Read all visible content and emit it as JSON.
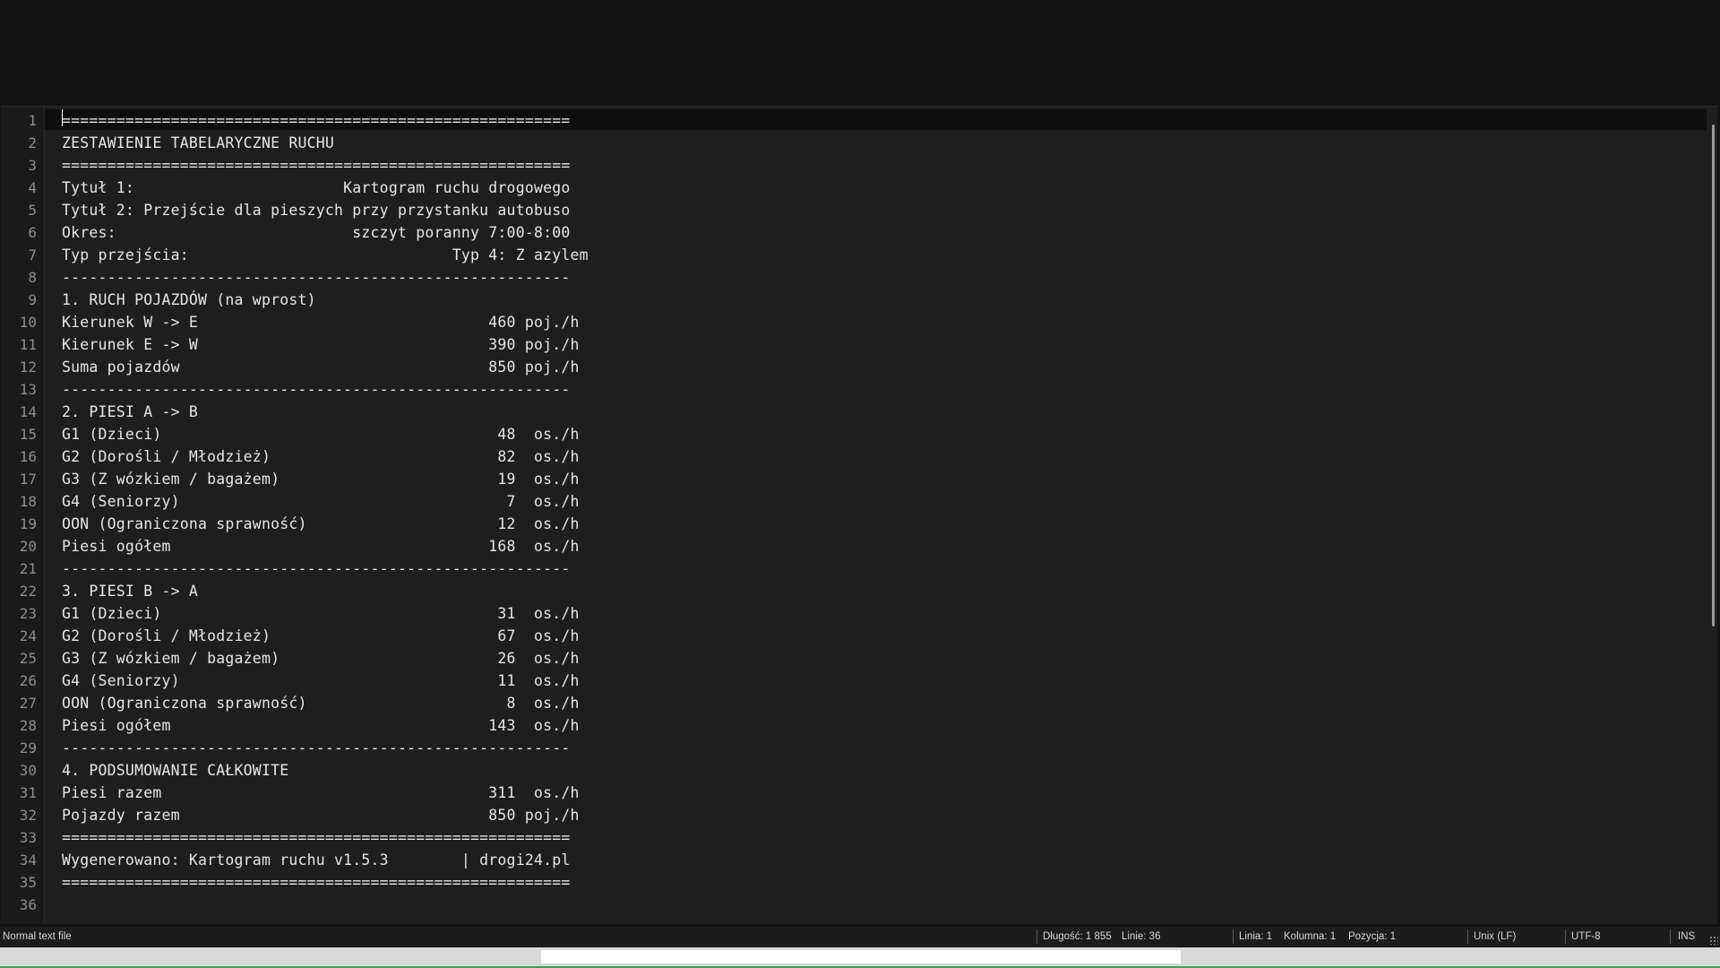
{
  "editor": {
    "lines": [
      {
        "n": "1",
        "text": "========================================================"
      },
      {
        "n": "2",
        "text": "ZESTAWIENIE TABELARYCZNE RUCHU"
      },
      {
        "n": "3",
        "text": "========================================================"
      },
      {
        "n": "4",
        "text": "Tytuł 1:                       Kartogram ruchu drogowego"
      },
      {
        "n": "5",
        "text": "Tytuł 2: Przejście dla pieszych przy przystanku autobuso"
      },
      {
        "n": "6",
        "text": "Okres:                          szczyt poranny 7:00-8:00"
      },
      {
        "n": "7",
        "text": "Typ przejścia:                             Typ 4: Z azylem"
      },
      {
        "n": "8",
        "text": "--------------------------------------------------------"
      },
      {
        "n": "9",
        "text": "1. RUCH POJAZDÓW (na wprost)"
      },
      {
        "n": "10",
        "text": "Kierunek W -> E                                460 poj./h"
      },
      {
        "n": "11",
        "text": "Kierunek E -> W                                390 poj./h"
      },
      {
        "n": "12",
        "text": "Suma pojazdów                                  850 poj./h"
      },
      {
        "n": "13",
        "text": "--------------------------------------------------------"
      },
      {
        "n": "14",
        "text": "2. PIESI A -> B"
      },
      {
        "n": "15",
        "text": "G1 (Dzieci)                                     48  os./h"
      },
      {
        "n": "16",
        "text": "G2 (Dorośli / Młodzież)                         82  os./h"
      },
      {
        "n": "17",
        "text": "G3 (Z wózkiem / bagażem)                        19  os./h"
      },
      {
        "n": "18",
        "text": "G4 (Seniorzy)                                    7  os./h"
      },
      {
        "n": "19",
        "text": "OON (Ograniczona sprawność)                     12  os./h"
      },
      {
        "n": "20",
        "text": "Piesi ogółem                                   168  os./h"
      },
      {
        "n": "21",
        "text": "--------------------------------------------------------"
      },
      {
        "n": "22",
        "text": "3. PIESI B -> A"
      },
      {
        "n": "23",
        "text": "G1 (Dzieci)                                     31  os./h"
      },
      {
        "n": "24",
        "text": "G2 (Dorośli / Młodzież)                         67  os./h"
      },
      {
        "n": "25",
        "text": "G3 (Z wózkiem / bagażem)                        26  os./h"
      },
      {
        "n": "26",
        "text": "G4 (Seniorzy)                                   11  os./h"
      },
      {
        "n": "27",
        "text": "OON (Ograniczona sprawność)                      8  os./h"
      },
      {
        "n": "28",
        "text": "Piesi ogółem                                   143  os./h"
      },
      {
        "n": "29",
        "text": "--------------------------------------------------------"
      },
      {
        "n": "30",
        "text": "4. PODSUMOWANIE CAŁKOWITE"
      },
      {
        "n": "31",
        "text": "Piesi razem                                    311  os./h"
      },
      {
        "n": "32",
        "text": "Pojazdy razem                                  850 poj./h"
      },
      {
        "n": "33",
        "text": "========================================================"
      },
      {
        "n": "34",
        "text": "Wygenerowano: Kartogram ruchu v1.5.3        | drogi24.pl"
      },
      {
        "n": "35",
        "text": "========================================================"
      },
      {
        "n": "36",
        "text": ""
      }
    ]
  },
  "statusbar": {
    "file_type": "Normal text file",
    "length": "Długość: 1 855",
    "lines": "Linie: 36",
    "line": "Linia: 1",
    "column": "Kolumna: 1",
    "position": "Pozycja: 1",
    "eol": "Unix (LF)",
    "encoding": "UTF-8",
    "mode": "INS"
  },
  "colors": {
    "background": "#1e1e1e",
    "text": "#e6e6e6",
    "line_numbers": "#8e8e8e",
    "accent": "#2fae3e"
  }
}
